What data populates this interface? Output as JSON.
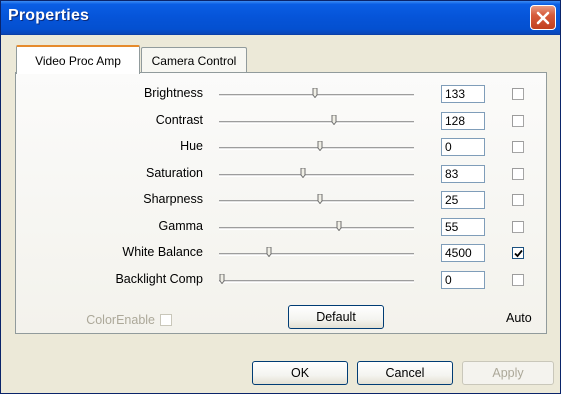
{
  "window": {
    "title": "Properties",
    "close_icon": "close-icon"
  },
  "tabs": [
    {
      "label": "Video Proc Amp",
      "active": true
    },
    {
      "label": "Camera Control",
      "active": false
    }
  ],
  "controls": [
    {
      "label": "Brightness",
      "value": "133",
      "slider_fraction": 0.49,
      "auto": false
    },
    {
      "label": "Contrast",
      "value": "128",
      "slider_fraction": 0.59,
      "auto": false
    },
    {
      "label": "Hue",
      "value": "0",
      "slider_fraction": 0.52,
      "auto": false
    },
    {
      "label": "Saturation",
      "value": "83",
      "slider_fraction": 0.43,
      "auto": false
    },
    {
      "label": "Sharpness",
      "value": "25",
      "slider_fraction": 0.52,
      "auto": false
    },
    {
      "label": "Gamma",
      "value": "55",
      "slider_fraction": 0.62,
      "auto": false
    },
    {
      "label": "White Balance",
      "value": "4500",
      "slider_fraction": 0.25,
      "auto": true
    },
    {
      "label": "Backlight Comp",
      "value": "0",
      "slider_fraction": 0.0,
      "auto": false
    }
  ],
  "color_enable": {
    "label": "ColorEnable",
    "checked": false,
    "disabled": true
  },
  "default_button": "Default",
  "auto_label": "Auto",
  "footer": {
    "ok": "OK",
    "cancel": "Cancel",
    "apply": "Apply"
  },
  "colors": {
    "titlebar": "#0654d8",
    "close_button": "#d65a3a",
    "background": "#ece9d8",
    "tab_highlight": "#e68b2c"
  }
}
